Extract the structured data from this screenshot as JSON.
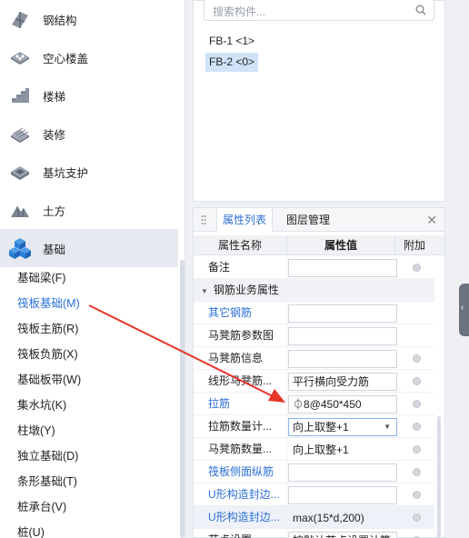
{
  "categories": [
    {
      "label": "钢结构",
      "icon": "steel-structure-icon"
    },
    {
      "label": "空心楼盖",
      "icon": "hollow-floor-icon"
    },
    {
      "label": "楼梯",
      "icon": "stairs-icon"
    },
    {
      "label": "装修",
      "icon": "decoration-icon"
    },
    {
      "label": "基坑支护",
      "icon": "pit-support-icon"
    },
    {
      "label": "土方",
      "icon": "earthwork-icon"
    },
    {
      "label": "基础",
      "icon": "foundation-icon"
    }
  ],
  "foundation_items": [
    "基础梁(F)",
    "筏板基础(M)",
    "筏板主筋(R)",
    "筏板负筋(X)",
    "基础板带(W)",
    "集水坑(K)",
    "柱墩(Y)",
    "独立基础(D)",
    "条形基础(T)",
    "桩承台(V)",
    "桩(U)"
  ],
  "search": {
    "placeholder": "搜索构件..."
  },
  "components": [
    "FB-1 <1>",
    "FB-2 <0>"
  ],
  "tabs": {
    "props": "属性列表",
    "layers": "图层管理"
  },
  "grid": {
    "col_name": "属性名称",
    "col_value": "属性值",
    "col_add": "附加"
  },
  "rows": [
    {
      "name": "备注",
      "value": "",
      "blue": false,
      "add": true
    },
    {
      "name": "钢筋业务属性",
      "group": true
    },
    {
      "name": "其它钢筋",
      "value": "",
      "blue": true,
      "add": false
    },
    {
      "name": "马凳筋参数图",
      "value": "",
      "blue": false,
      "add": false
    },
    {
      "name": "马凳筋信息",
      "value": "",
      "blue": false,
      "add": true
    },
    {
      "name": "线形马凳筋...",
      "value": "平行横向受力筋",
      "blue": false,
      "add": true
    },
    {
      "name": "拉筋",
      "value": "⏀8@450*450",
      "blue": true,
      "add": true
    },
    {
      "name": "拉筋数量计...",
      "value": "向上取整+1",
      "blue": false,
      "add": true,
      "dropdown": true
    },
    {
      "name": "马凳筋数量...",
      "value": "向上取整+1",
      "blue": false,
      "add": true,
      "noborder": true
    },
    {
      "name": "筏板侧面纵筋",
      "value": "",
      "blue": true,
      "add": true
    },
    {
      "name": "U形构造封边...",
      "value": "",
      "blue": true,
      "add": true
    },
    {
      "name": "U形构造封边...",
      "value": "max(15*d,200)",
      "blue": true,
      "add": true,
      "highlight": true,
      "noborder": true
    },
    {
      "name": "节点设置",
      "value": "按默认节点设置计算",
      "blue": false,
      "add": true
    }
  ],
  "colors": {
    "accent": "#2b6fd6",
    "arrow": "#e8352b",
    "selected": "#cfe2f8"
  }
}
